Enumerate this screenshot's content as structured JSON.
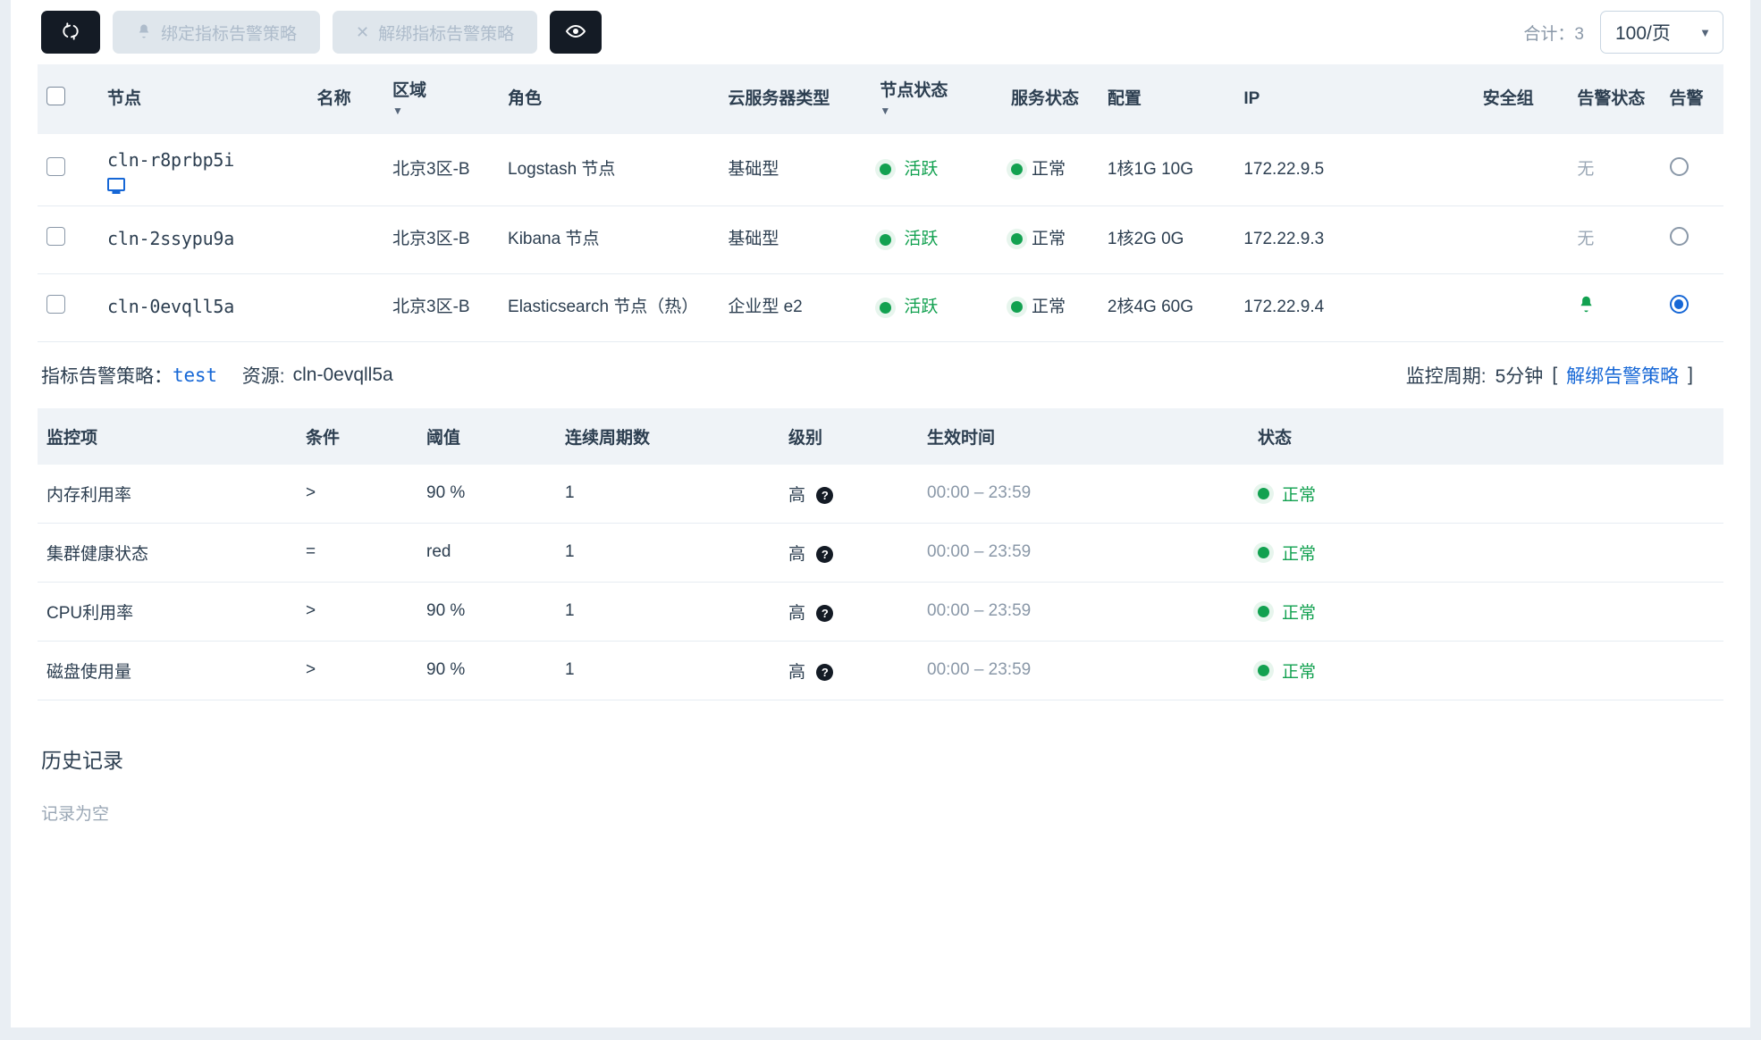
{
  "toolbar": {
    "refresh_icon": "refresh-icon",
    "bind_policy_label": "绑定指标告警策略",
    "bind_policy_icon": "bell-icon",
    "unbind_policy_label": "解绑指标告警策略",
    "unbind_policy_icon": "x-icon",
    "eye_icon": "eye-icon",
    "total_label": "合计：3",
    "page_size_value": "100/页",
    "page_size_caret": "▼"
  },
  "colors": {
    "accent": "#1667d6",
    "success": "#12a150",
    "dark": "#141b25",
    "header_bg": "#eff3f7",
    "muted": "#9aa7b5"
  },
  "nodes_table": {
    "columns": [
      {
        "label": "节点",
        "sortable": false
      },
      {
        "label": "名称",
        "sortable": false
      },
      {
        "label": "区域",
        "sortable": true,
        "caret": "▼"
      },
      {
        "label": "角色",
        "sortable": false
      },
      {
        "label": "云服务器类型",
        "sortable": false
      },
      {
        "label": "节点状态",
        "sortable": true,
        "caret": "▼"
      },
      {
        "label": "服务状态",
        "sortable": false
      },
      {
        "label": "配置",
        "sortable": false
      },
      {
        "label": "IP",
        "sortable": false
      },
      {
        "label": "安全组",
        "sortable": false
      },
      {
        "label": "告警状态",
        "sortable": false
      },
      {
        "label": "告警",
        "sortable": false
      }
    ],
    "rows": [
      {
        "node": "cln-r8prbp5i",
        "node_icon": "monitor-icon",
        "name": "",
        "zone": "北京3区-B",
        "role": "Logstash 节点",
        "server_type": "基础型",
        "node_status": "活跃",
        "service_status": "正常",
        "config": "1核1G 10G",
        "ip": "172.22.9.5",
        "security_group": "",
        "alarm_status": "无",
        "alarm_selected": false
      },
      {
        "node": "cln-2ssypu9a",
        "node_icon": "",
        "name": "",
        "zone": "北京3区-B",
        "role": "Kibana 节点",
        "server_type": "基础型",
        "node_status": "活跃",
        "service_status": "正常",
        "config": "1核2G 0G",
        "ip": "172.22.9.3",
        "security_group": "",
        "alarm_status": "无",
        "alarm_selected": false
      },
      {
        "node": "cln-0evqll5a",
        "node_icon": "",
        "name": "",
        "zone": "北京3区-B",
        "role": "Elasticsearch 节点（热）",
        "server_type": "企业型 e2",
        "node_status": "活跃",
        "service_status": "正常",
        "config": "2核4G 60G",
        "ip": "172.22.9.4",
        "security_group": "",
        "alarm_status": "bell-icon",
        "alarm_selected": true
      }
    ]
  },
  "policy_bar": {
    "policy_label": "指标告警策略：",
    "policy_name": "test",
    "resource_label": "资源:",
    "resource_value": "cln-0evqll5a",
    "period_label": "监控周期:",
    "period_value": "5分钟",
    "bracket_open": "[",
    "unbind_link": "解绑告警策略",
    "bracket_close": "]"
  },
  "metrics_table": {
    "columns": [
      "监控项",
      "条件",
      "阈值",
      "连续周期数",
      "级别",
      "生效时间",
      "状态"
    ],
    "rows": [
      {
        "item": "内存利用率",
        "cond": ">",
        "threshold": "90 %",
        "periods": "1",
        "level": "高",
        "effective_time": "00:00 – 23:59",
        "status": "正常"
      },
      {
        "item": "集群健康状态",
        "cond": "=",
        "threshold": "red",
        "periods": "1",
        "level": "高",
        "effective_time": "00:00 – 23:59",
        "status": "正常"
      },
      {
        "item": "CPU利用率",
        "cond": ">",
        "threshold": "90 %",
        "periods": "1",
        "level": "高",
        "effective_time": "00:00 – 23:59",
        "status": "正常"
      },
      {
        "item": "磁盘使用量",
        "cond": ">",
        "threshold": "90 %",
        "periods": "1",
        "level": "高",
        "effective_time": "00:00 – 23:59",
        "status": "正常"
      }
    ]
  },
  "history": {
    "title": "历史记录",
    "empty_text": "记录为空"
  }
}
